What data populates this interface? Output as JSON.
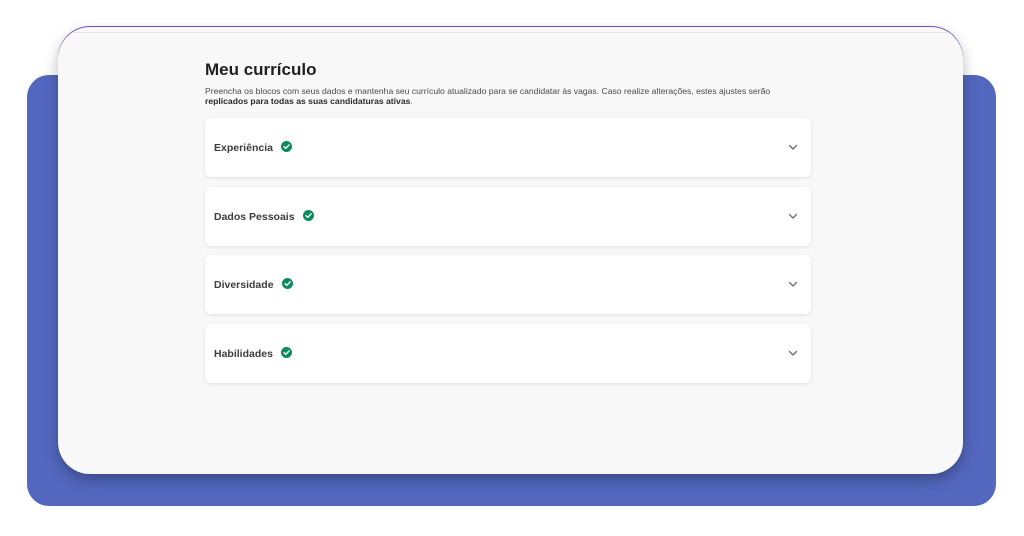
{
  "page": {
    "title": "Meu currículo",
    "description_plain": "Preencha os blocos com seus dados e mantenha seu currículo atualizado para se candidatar às vagas. Caso realize alterações, estes ajustes serão ",
    "description_bold": "replicados para todas as suas candidaturas ativas",
    "description_end": "."
  },
  "sections": [
    {
      "label": "Experiência",
      "status_icon": "check-circle-icon",
      "toggle_icon": "chevron-down-icon"
    },
    {
      "label": "Dados Pessoais",
      "status_icon": "check-circle-icon",
      "toggle_icon": "chevron-down-icon"
    },
    {
      "label": "Diversidade",
      "status_icon": "check-circle-icon",
      "toggle_icon": "chevron-down-icon"
    },
    {
      "label": "Habilidades",
      "status_icon": "check-circle-icon",
      "toggle_icon": "chevron-down-icon"
    }
  ],
  "colors": {
    "backdrop": "#5367bf",
    "card": "#f8f8f8",
    "check": "#0e8a5f",
    "title": "#1f1f1f"
  }
}
